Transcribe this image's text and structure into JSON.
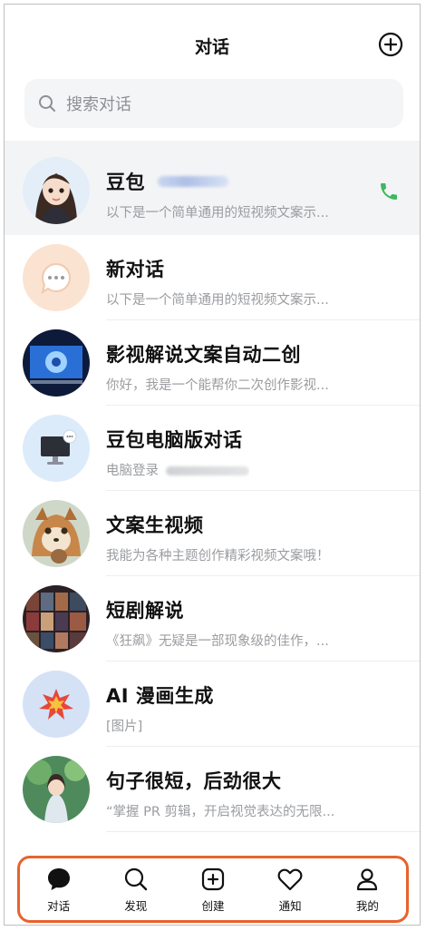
{
  "header": {
    "title": "对话"
  },
  "search": {
    "placeholder": "搜索对话"
  },
  "conversations": [
    {
      "title": "豆包",
      "subtitle": "以下是一个简单通用的短视频文案示..."
    },
    {
      "title": "新对话",
      "subtitle": "以下是一个简单通用的短视频文案示..."
    },
    {
      "title": "影视解说文案自动二创",
      "subtitle": "你好，我是一个能帮你二次创作影视..."
    },
    {
      "title": "豆包电脑版对话",
      "subtitle": "电脑登录"
    },
    {
      "title": "文案生视频",
      "subtitle": "我能为各种主题创作精彩视频文案哦！"
    },
    {
      "title": "短剧解说",
      "subtitle": "《狂飙》无疑是一部现象级的佳作，..."
    },
    {
      "title": "AI 漫画生成",
      "subtitle": "[图片]"
    },
    {
      "title": "句子很短，后劲很大",
      "subtitle": "“掌握 PR 剪辑，开启视觉表达的无限..."
    }
  ],
  "tabs": [
    {
      "label": "对话",
      "icon": "chat-bubble-icon"
    },
    {
      "label": "发现",
      "icon": "search-icon"
    },
    {
      "label": "创建",
      "icon": "plus-square-icon"
    },
    {
      "label": "通知",
      "icon": "heart-icon"
    },
    {
      "label": "我的",
      "icon": "person-icon"
    }
  ],
  "colors": {
    "accent_highlight": "#e8622c",
    "phone_green": "#3db860"
  }
}
